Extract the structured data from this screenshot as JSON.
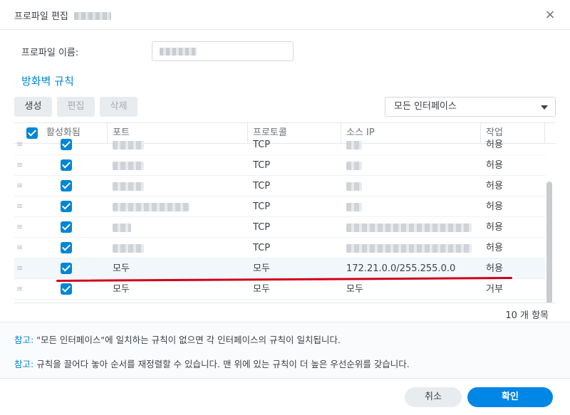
{
  "window": {
    "title": "프로파일 편집",
    "close_label": "×"
  },
  "profile": {
    "label": "프로파일 이름:"
  },
  "section": {
    "title": "방화벽 규칙"
  },
  "toolbar": {
    "create_label": "생성",
    "edit_label": "편집",
    "delete_label": "삭제"
  },
  "interface_select": {
    "value": "모든 인터페이스"
  },
  "table": {
    "columns": {
      "enabled": "활성화됨",
      "port": "포트",
      "protocol": "프로토콜",
      "source_ip": "소스 IP",
      "action": "작업"
    },
    "rows": [
      {
        "port": "",
        "protocol": "TCP",
        "source_ip": "",
        "action": "허용"
      },
      {
        "port": "",
        "protocol": "TCP",
        "source_ip": "",
        "action": "허용"
      },
      {
        "port": "",
        "protocol": "TCP",
        "source_ip": "",
        "action": "허용"
      },
      {
        "port": "",
        "protocol": "TCP",
        "source_ip": "",
        "action": "허용"
      },
      {
        "port": "",
        "protocol": "TCP",
        "source_ip": "",
        "action": "허용"
      },
      {
        "port": "",
        "protocol": "TCP",
        "source_ip": "",
        "action": "허용"
      },
      {
        "port": "모두",
        "protocol": "모두",
        "source_ip": "172.21.0.0/255.255.0.0",
        "action": "허용"
      },
      {
        "port": "모두",
        "protocol": "모두",
        "source_ip": "모두",
        "action": "거부"
      }
    ],
    "count_label": "10 개 항목"
  },
  "notes": {
    "note1_label": "참고:",
    "note1_text": " \"모든 인터페이스\"에 일치하는 규칙이 없으면 각 인터페이스의 규칙이 일치됩니다.",
    "note2_label": "참고:",
    "note2_text": " 규칙을 끌어다 놓아 순서를 재정렬할 수 있습니다. 맨 위에 있는 규칙이 더 높은 우선순위를 갖습니다."
  },
  "footer": {
    "cancel_label": "취소",
    "ok_label": "확인"
  },
  "colors": {
    "accent": "#0086d6",
    "primary_button": "#0086e5",
    "annotation_line": "#d0001b"
  }
}
